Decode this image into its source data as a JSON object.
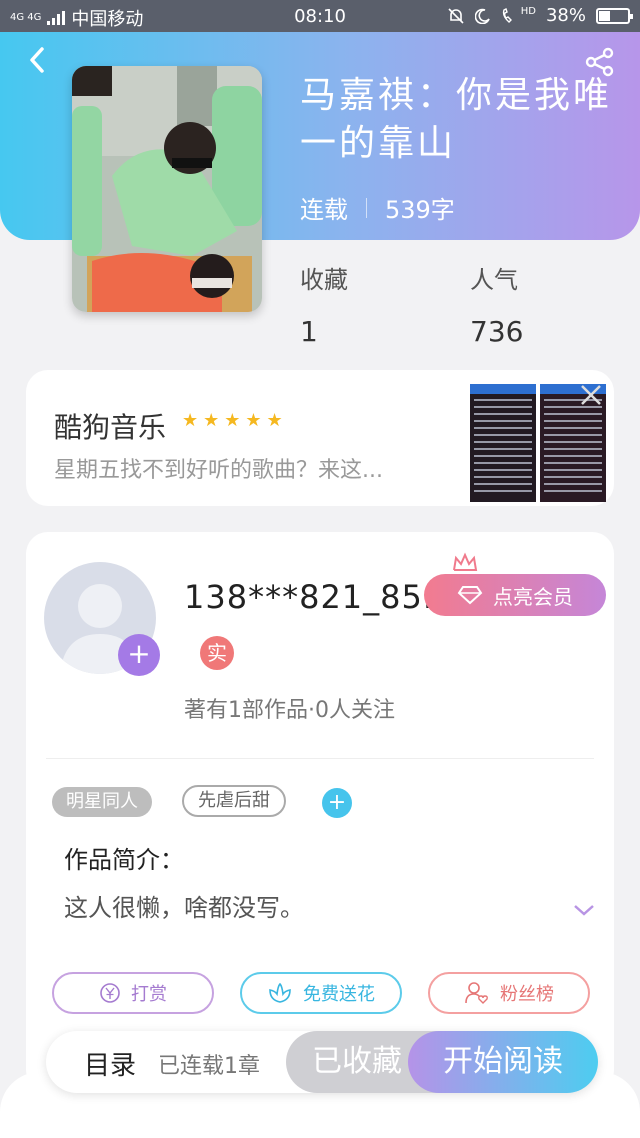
{
  "status_bar": {
    "network": "4G 4G",
    "carrier": "中国移动",
    "time": "08:10",
    "hd": "HD",
    "battery": "38%",
    "battery_level": 0.38
  },
  "book": {
    "title": "马嘉祺：你是我唯一的靠山",
    "status": "连载",
    "word_count": "539字",
    "favorites_label": "收藏",
    "favorites_value": "1",
    "popularity_label": "人气",
    "popularity_value": "736"
  },
  "ad": {
    "name": "酷狗音乐",
    "stars": "★★★★★",
    "rating": 5,
    "description": "星期五找不到好听的歌曲？来这..."
  },
  "author": {
    "username": "138***821_85...",
    "real_badge": "实",
    "vip_label": "点亮会员",
    "subtitle": "著有1部作品·0人关注"
  },
  "tags": [
    "明星同人",
    "先虐后甜"
  ],
  "intro": {
    "title": "作品简介：",
    "text": "这人很懒，啥都没写。"
  },
  "actions": {
    "reward": "打赏",
    "flower": "免费送花",
    "fans": "粉丝榜"
  },
  "bottom": {
    "toc": "目录",
    "toc_sub": "已连载1章",
    "collected": "已收藏",
    "read": "开始阅读"
  },
  "colors": {
    "header_start": "#46c8f0",
    "header_end": "#b796ea",
    "vip_start": "#f27b8f",
    "vip_end": "#c586d8",
    "read_start": "#b593e8",
    "read_end": "#4dcdf0"
  }
}
